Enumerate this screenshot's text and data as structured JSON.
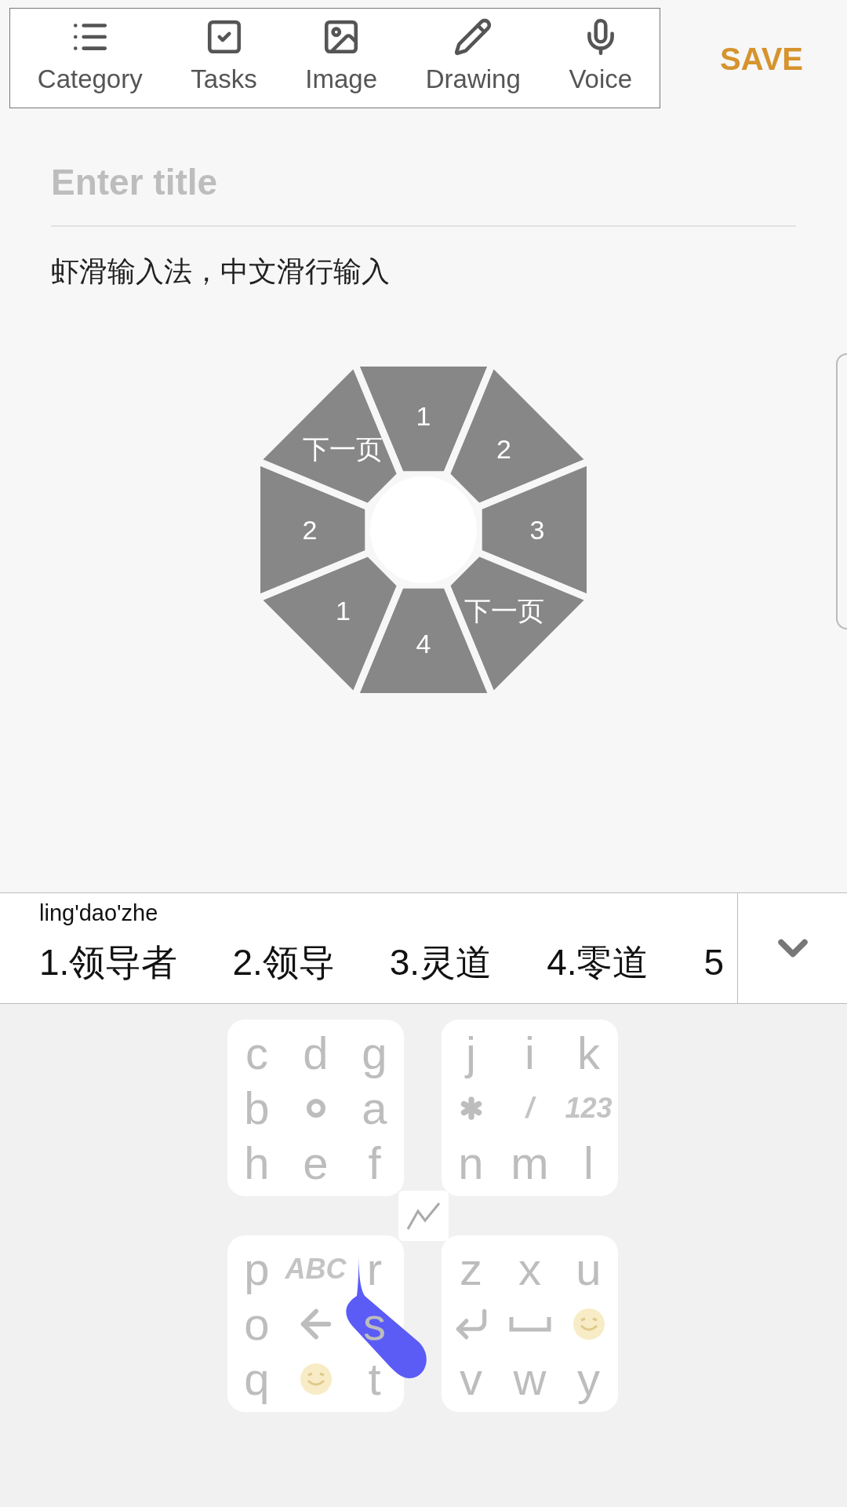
{
  "toolbar": {
    "items": [
      {
        "kind": "category",
        "label": "Category"
      },
      {
        "kind": "tasks",
        "label": "Tasks"
      },
      {
        "kind": "image",
        "label": "Image"
      },
      {
        "kind": "drawing",
        "label": "Drawing"
      },
      {
        "kind": "voice",
        "label": "Voice"
      }
    ],
    "save": "SAVE"
  },
  "note": {
    "title_placeholder": "Enter title",
    "body": "虾滑输入法，中文滑行输入"
  },
  "wheel": {
    "segments": [
      "1",
      "2",
      "3",
      "下一页",
      "4",
      "1",
      "2",
      "下一页"
    ]
  },
  "candidates": {
    "pinyin": "ling'dao'zhe",
    "items": [
      "1.领导者",
      "2.领导",
      "3.灵道",
      "4.零道",
      "5"
    ]
  },
  "keyboard": {
    "clusters": [
      {
        "keys": [
          {
            "kind": "text",
            "label": "c"
          },
          {
            "kind": "text",
            "label": "d"
          },
          {
            "kind": "text",
            "label": "g"
          },
          {
            "kind": "text",
            "label": "b"
          },
          {
            "kind": "dot"
          },
          {
            "kind": "text",
            "label": "a"
          },
          {
            "kind": "text",
            "label": "h"
          },
          {
            "kind": "text",
            "label": "e"
          },
          {
            "kind": "text",
            "label": "f"
          }
        ]
      },
      {
        "keys": [
          {
            "kind": "text",
            "label": "j"
          },
          {
            "kind": "text",
            "label": "i"
          },
          {
            "kind": "text",
            "label": "k"
          },
          {
            "kind": "asterisk"
          },
          {
            "kind": "bold",
            "label": "/"
          },
          {
            "kind": "bold",
            "label": "123"
          },
          {
            "kind": "text",
            "label": "n"
          },
          {
            "kind": "text",
            "label": "m"
          },
          {
            "kind": "text",
            "label": "l"
          }
        ]
      },
      {
        "keys": [
          {
            "kind": "text",
            "label": "p"
          },
          {
            "kind": "bold",
            "label": "ABC"
          },
          {
            "kind": "text",
            "label": "r"
          },
          {
            "kind": "text",
            "label": "o"
          },
          {
            "kind": "back"
          },
          {
            "kind": "text",
            "label": "s"
          },
          {
            "kind": "text",
            "label": "q"
          },
          {
            "kind": "emoji"
          },
          {
            "kind": "text",
            "label": "t"
          }
        ]
      },
      {
        "keys": [
          {
            "kind": "text",
            "label": "z"
          },
          {
            "kind": "text",
            "label": "x"
          },
          {
            "kind": "text",
            "label": "u"
          },
          {
            "kind": "enter"
          },
          {
            "kind": "space"
          },
          {
            "kind": "emoji"
          },
          {
            "kind": "text",
            "label": "v"
          },
          {
            "kind": "text",
            "label": "w"
          },
          {
            "kind": "text",
            "label": "y"
          }
        ]
      }
    ]
  }
}
